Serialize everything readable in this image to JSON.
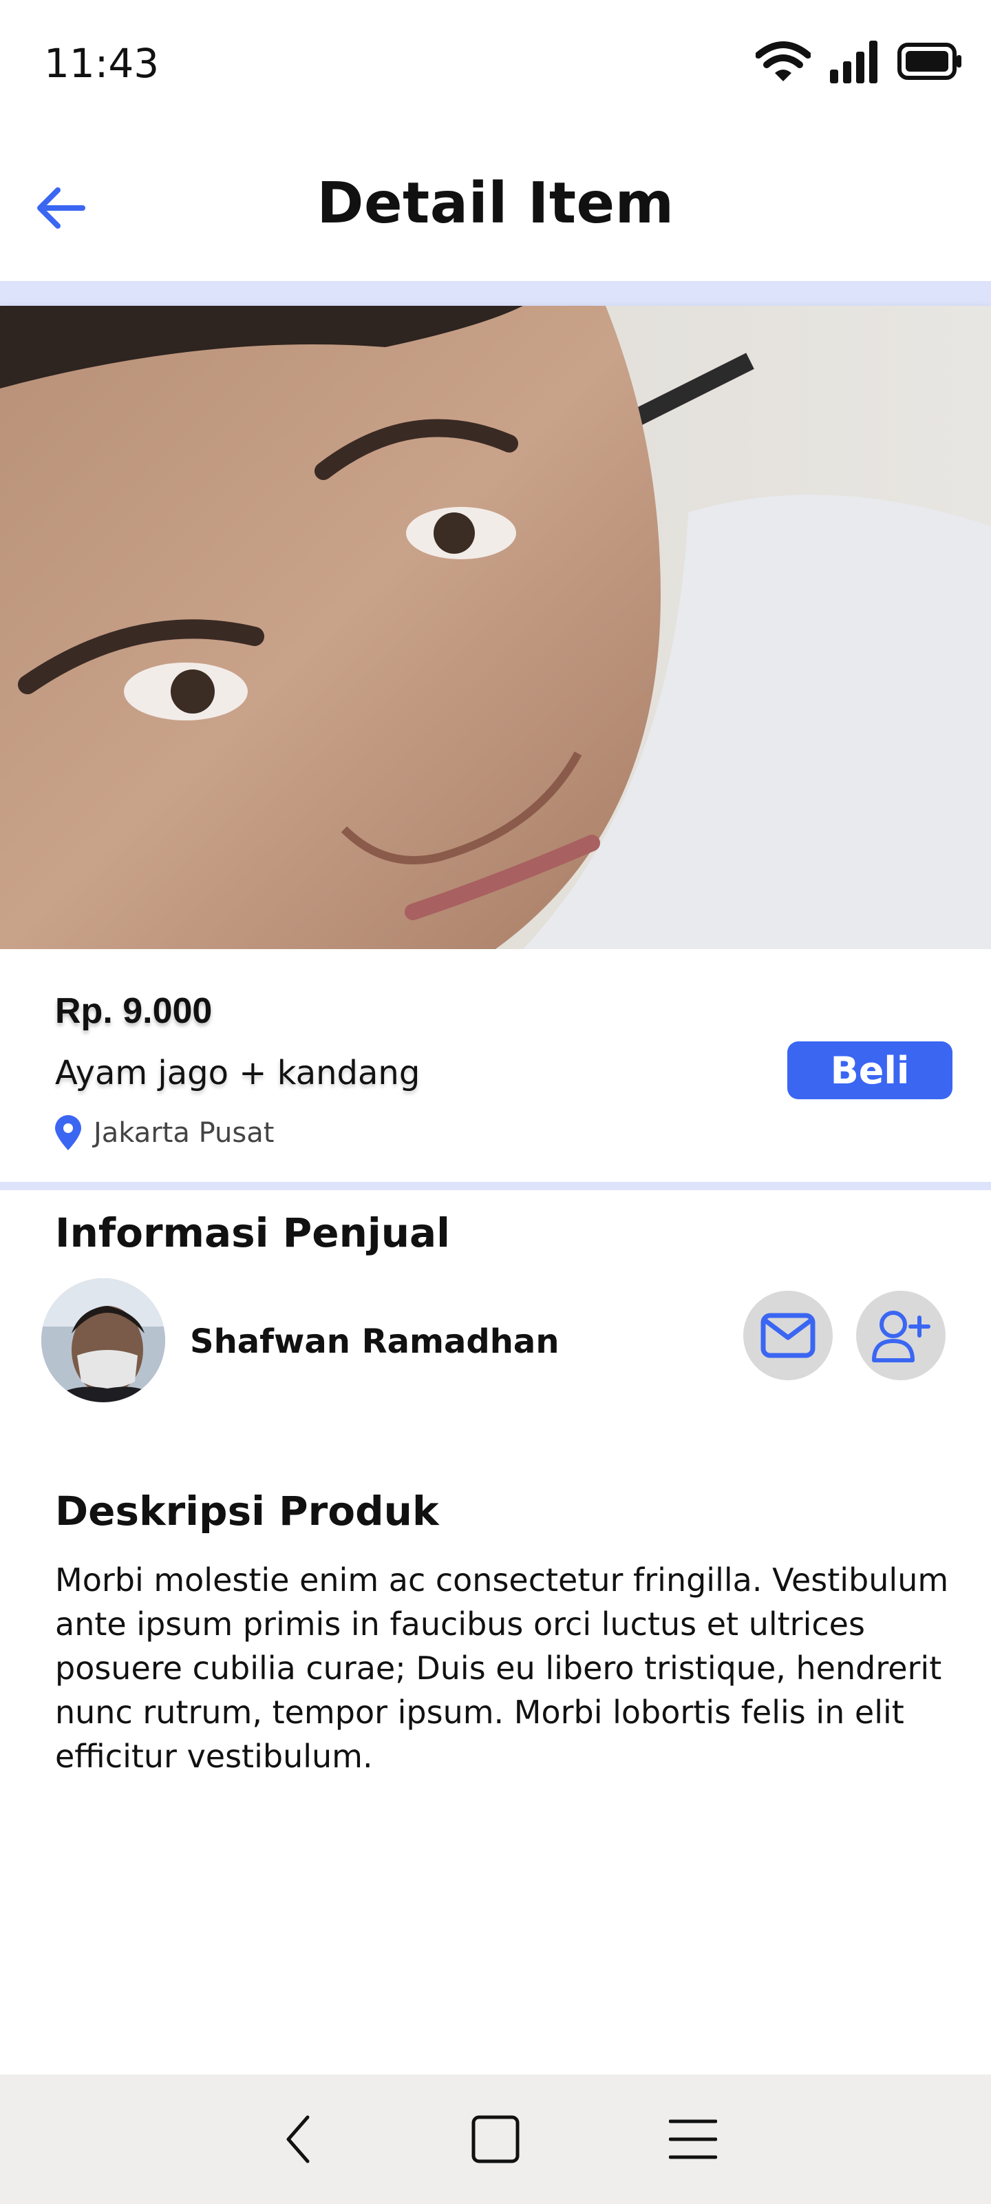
{
  "status_bar": {
    "time": "11:43"
  },
  "header": {
    "title": "Detail Item"
  },
  "product": {
    "price": "Rp. 9.000",
    "name": "Ayam jago + kandang",
    "location": "Jakarta Pusat",
    "buy_label": "Beli"
  },
  "seller": {
    "heading": "Informasi Penjual",
    "name": "Shafwan Ramadhan"
  },
  "description": {
    "heading": "Deskripsi Produk",
    "text": "Morbi molestie enim ac consectetur fringilla. Vestibulum ante ipsum primis in faucibus orci luctus et ultrices posuere cubilia curae; Duis eu libero tristique, hendrerit nunc rutrum, tempor ipsum. Morbi lobortis felis in elit efficitur vestibulum."
  },
  "icons": {
    "back": "arrow-left-icon",
    "location": "map-pin-icon",
    "message": "mail-icon",
    "follow": "user-plus-icon",
    "nav_back": "chevron-left-icon",
    "nav_home": "square-icon",
    "nav_menu": "hamburger-icon"
  },
  "colors": {
    "accent": "#3a66f2",
    "divider": "#dce3fb",
    "icon_button_bg": "#d9d9d9",
    "nav_bg": "#efeeec"
  }
}
